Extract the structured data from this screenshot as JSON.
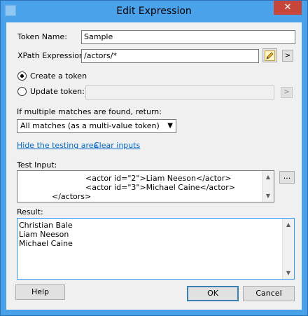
{
  "window": {
    "title": "Edit Expression",
    "close_glyph": "✕"
  },
  "token_name": {
    "label": "Token Name:",
    "value": "Sample"
  },
  "xpath": {
    "label": "XPath Expression:",
    "value": "/actors/*",
    "next_glyph": ">"
  },
  "radio": {
    "create_label": "Create a token",
    "update_label": "Update token:",
    "create_selected": true,
    "update_value": "",
    "update_next_glyph": ">"
  },
  "multiple": {
    "label": "If multiple matches are found, return:",
    "selected": "All matches (as a multi-value token)"
  },
  "links": {
    "hide_testing": "Hide the testing area",
    "clear_inputs": "Clear inputs"
  },
  "test_input": {
    "label": "Test Input:",
    "lines": [
      "<actor id=\"2\">Liam Neeson</actor>",
      "<actor id=\"3\">Michael Caine</actor>",
      "</actors>"
    ],
    "browse_glyph": "..."
  },
  "result": {
    "label": "Result:",
    "lines": [
      "Christian Bale",
      "Liam Neeson",
      "Michael Caine"
    ]
  },
  "buttons": {
    "help": "Help",
    "ok": "OK",
    "cancel": "Cancel"
  },
  "icons": {
    "pencil": "pencil-icon",
    "up": "▲",
    "down": "▼"
  }
}
